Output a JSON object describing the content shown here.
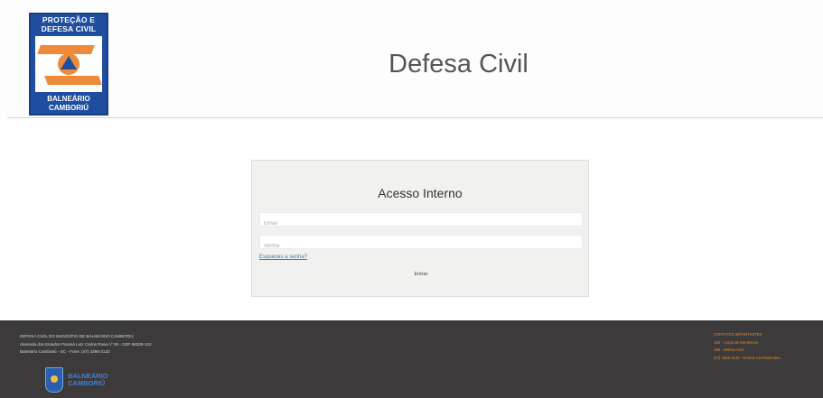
{
  "header": {
    "logo": {
      "line1": "PROTEÇÃO E",
      "line2": "DEFESA CIVIL",
      "bottom1": "BALNEÁRIO",
      "bottom2": "CAMBORIÚ"
    },
    "title": "Defesa Civil"
  },
  "login": {
    "title": "Acesso Interno",
    "email_placeholder": "Email",
    "senha_placeholder": "Senha",
    "forgot_label": "Esqueceu a senha?",
    "submit_label": "Entrar"
  },
  "footer": {
    "left_lines": [
      "DEFESA CIVIL DO MUNICÍPIO DE BALNEÁRIO CAMBORIÚ",
      "Alameda dos Estados Paraná Luiz Carlos Rosa nº 29 - CEP 88338-122",
      "Balneário Camboriú - SC - Fone: (47) 3366-3133"
    ],
    "logo_text_1": "BALNEÁRIO",
    "logo_text_2": "CAMBORIÚ",
    "right_lines": [
      "CONTATOS IMPORTANTES",
      "193 - Corpo de Bombeiros",
      "199 - Defesa Civil",
      "(47) 3366-3133 - Defesa Civil Balneário"
    ]
  },
  "colors": {
    "logo_blue": "#1f4ea1",
    "logo_orange": "#ef8a3a",
    "footer_bg": "#3c3a3a",
    "footer_accent": "#e08a33",
    "link_blue": "#3a7bb8"
  }
}
